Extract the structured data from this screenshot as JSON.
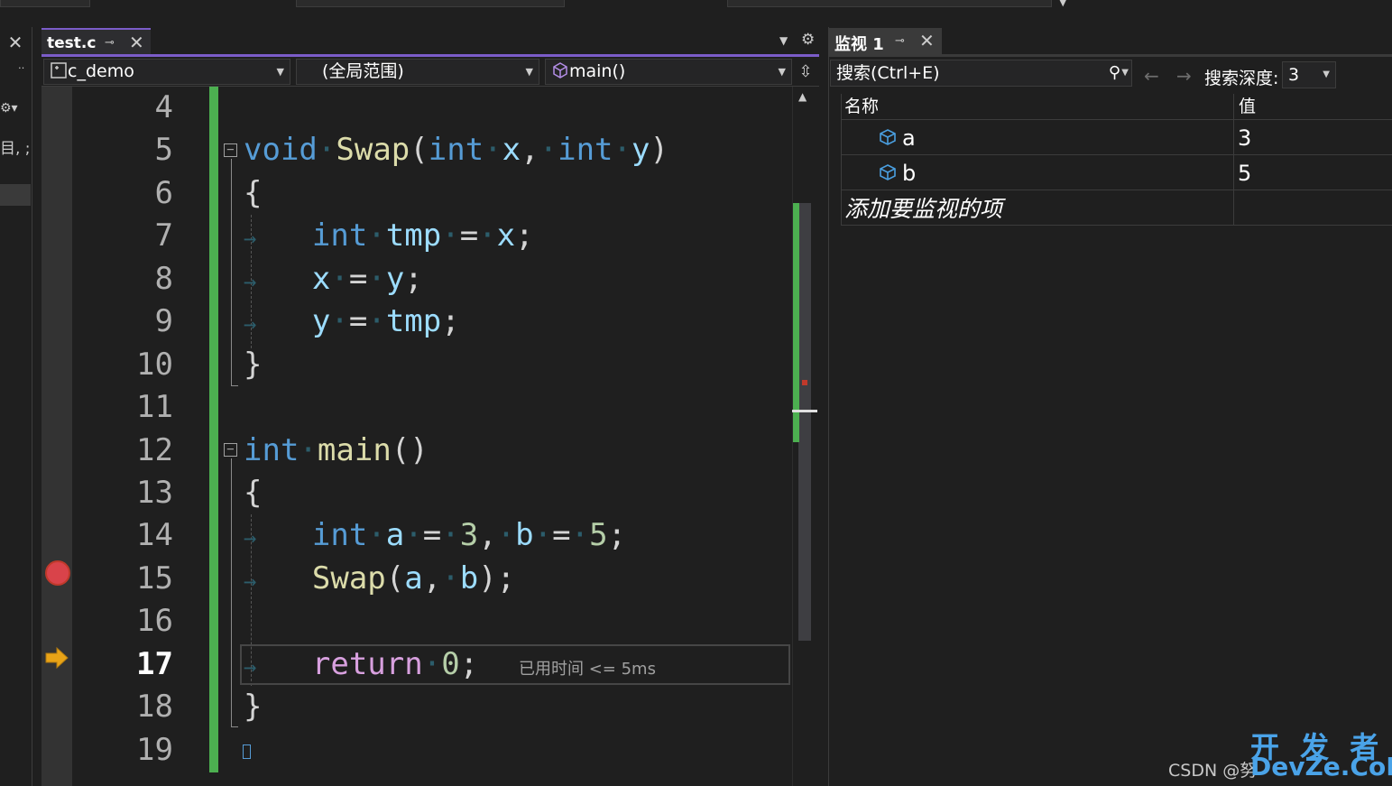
{
  "editor": {
    "tab": {
      "title": "test.c",
      "pin": "⊸",
      "close": "✕"
    },
    "nav": {
      "project": "c_demo",
      "scope": "(全局范围)",
      "member": "main()"
    },
    "current_line": "17",
    "hint": "已用时间 <= 5ms",
    "lines": [
      {
        "n": "4"
      },
      {
        "n": "5"
      },
      {
        "n": "6"
      },
      {
        "n": "7"
      },
      {
        "n": "8"
      },
      {
        "n": "9"
      },
      {
        "n": "10"
      },
      {
        "n": "11"
      },
      {
        "n": "12"
      },
      {
        "n": "13"
      },
      {
        "n": "14"
      },
      {
        "n": "15"
      },
      {
        "n": "16"
      },
      {
        "n": "17"
      },
      {
        "n": "18"
      },
      {
        "n": "19"
      }
    ],
    "code": {
      "l5": {
        "kw1": "void",
        "fn": "Swap",
        "p1": "(",
        "kw2": "int",
        "a1": "x",
        "c1": ",",
        "kw3": "int",
        "a2": "y",
        "p2": ")"
      },
      "l6": "{",
      "l7": {
        "kw": "int",
        "v": "tmp",
        "op": "=",
        "x": "x",
        "sc": ";"
      },
      "l8": {
        "x": "x",
        "op": "=",
        "y": "y",
        "sc": ";"
      },
      "l9": {
        "y": "y",
        "op": "=",
        "v": "tmp",
        "sc": ";"
      },
      "l10": "}",
      "l12": {
        "kw": "int",
        "fn": "main",
        "p": "()"
      },
      "l13": "{",
      "l14": {
        "kw": "int",
        "a": "a",
        "op1": "=",
        "n1": "3",
        "c": ",",
        "b": "b",
        "op2": "=",
        "n2": "5",
        "sc": ";"
      },
      "l15": {
        "fn": "Swap",
        "p1": "(",
        "a": "a",
        "c": ",",
        "b": "b",
        "p2": ")",
        "sc": ";"
      },
      "l17": {
        "kw": "return",
        "n": "0",
        "sc": ";"
      },
      "l18": "}"
    }
  },
  "watch": {
    "tab": {
      "title": "监视 1",
      "pin": "⊸",
      "close": "✕"
    },
    "search_placeholder": "搜索(Ctrl+E)",
    "depth_label": "搜索深度:",
    "depth_value": "3",
    "columns": {
      "name": "名称",
      "value": "值"
    },
    "rows": [
      {
        "name": "a",
        "value": "3"
      },
      {
        "name": "b",
        "value": "5"
      }
    ],
    "add_item": "添加要监视的项"
  },
  "left_panel": {
    "text": "目, ;"
  },
  "footer": {
    "credit": "CSDN @努",
    "watermark_top": "开 发 者",
    "watermark_bottom": "DevZe.CoM"
  },
  "colors": {
    "keyword": "#569cd6",
    "function": "#dcdcaa",
    "param": "#9cdcfe",
    "number": "#b5cea8",
    "return": "#d8a0df",
    "accent": "#7b5cc8",
    "change_bar": "#4caf50",
    "breakpoint": "#d9434a"
  }
}
